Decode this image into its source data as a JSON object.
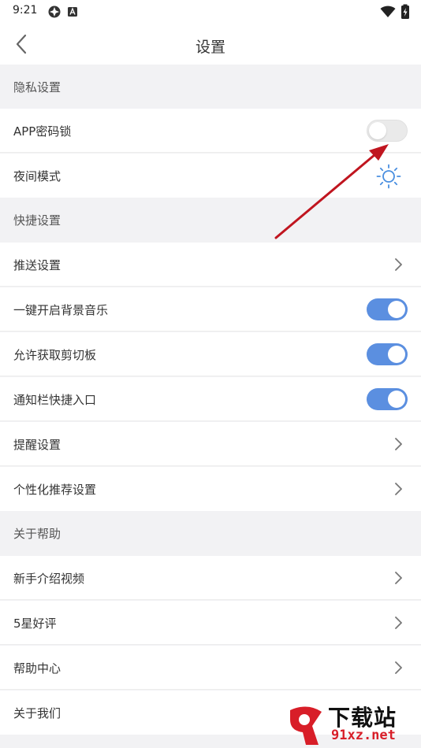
{
  "status_bar": {
    "time": "9:21"
  },
  "header": {
    "title": "设置"
  },
  "sections": [
    {
      "title": "隐私设置"
    },
    {
      "title": "快捷设置"
    },
    {
      "title": "关于帮助"
    }
  ],
  "rows": {
    "app_lock": {
      "label": "APP密码锁",
      "toggle": "off"
    },
    "night_mode": {
      "label": "夜间模式"
    },
    "push_settings": {
      "label": "推送设置"
    },
    "bg_music": {
      "label": "一键开启背景音乐",
      "toggle": "on"
    },
    "clipboard": {
      "label": "允许获取剪切板",
      "toggle": "on"
    },
    "notif_shortcut": {
      "label": "通知栏快捷入口",
      "toggle": "on"
    },
    "reminder": {
      "label": "提醒设置"
    },
    "personalized": {
      "label": "个性化推荐设置"
    },
    "intro_video": {
      "label": "新手介绍视频"
    },
    "rate": {
      "label": "5星好评"
    },
    "help_center": {
      "label": "帮助中心"
    },
    "about_us": {
      "label": "关于我们"
    }
  },
  "watermark": {
    "line1": "下载站",
    "line2": "91xz.net"
  },
  "colors": {
    "toggle_on": "#5b8fe0",
    "annotation_arrow": "#d81e28",
    "section_bg": "#f2f2f4"
  }
}
